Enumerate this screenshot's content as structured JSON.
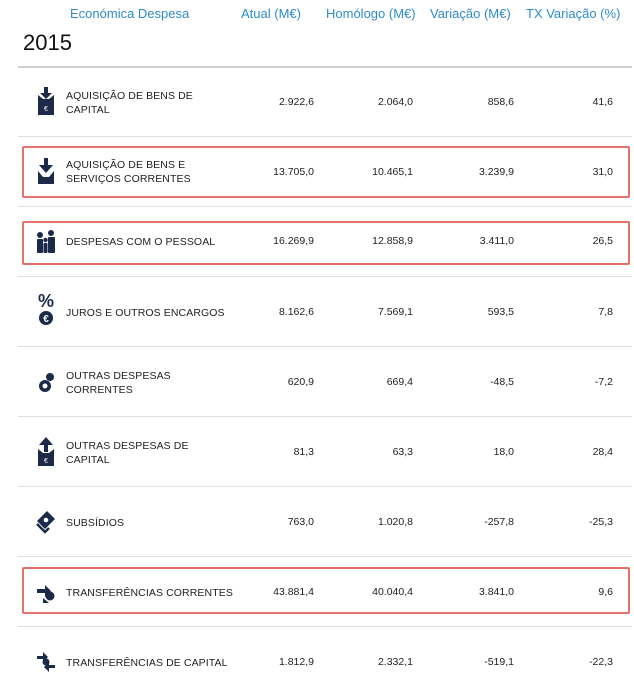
{
  "header": {
    "category": "Económica Despesa",
    "current": "Atual (M€)",
    "previous": "Homólogo (M€)",
    "variation": "Variação (M€)",
    "variation_rate": "TX Variação (%)"
  },
  "year": "2015",
  "rows": [
    {
      "label_l1": "AQUISIÇÃO DE BENS DE",
      "label_l2": "CAPITAL",
      "icon": "capital-goods-icon",
      "current": "2.922,6",
      "previous": "2.064,0",
      "variation": "858,6",
      "rate": "41,6",
      "highlighted": false
    },
    {
      "label_l1": "AQUISIÇÃO DE BENS E",
      "label_l2": "SERVIÇOS CORRENTES",
      "icon": "goods-services-icon",
      "current": "13.705,0",
      "previous": "10.465,1",
      "variation": "3.239,9",
      "rate": "31,0",
      "highlighted": true
    },
    {
      "label_l1": "DESPESAS COM O PESSOAL",
      "label_l2": "",
      "icon": "people-icon",
      "current": "16.269,9",
      "previous": "12.858,9",
      "variation": "3.411,0",
      "rate": "26,5",
      "highlighted": true
    },
    {
      "label_l1": "JUROS E OUTROS ENCARGOS",
      "label_l2": "",
      "icon": "percent-euro-icon",
      "current": "8.162,6",
      "previous": "7.569,1",
      "variation": "593,5",
      "rate": "7,8",
      "highlighted": false
    },
    {
      "label_l1": "OUTRAS DESPESAS",
      "label_l2": "CORRENTES",
      "icon": "coins-icon",
      "current": "620,9",
      "previous": "669,4",
      "variation": "-48,5",
      "rate": "-7,2",
      "highlighted": false
    },
    {
      "label_l1": "OUTRAS DESPESAS DE",
      "label_l2": "CAPITAL",
      "icon": "capital-out-icon",
      "current": "81,3",
      "previous": "63,3",
      "variation": "18,0",
      "rate": "28,4",
      "highlighted": false
    },
    {
      "label_l1": "SUBSÍDIOS",
      "label_l2": "",
      "icon": "subsidy-icon",
      "current": "763,0",
      "previous": "1.020,8",
      "variation": "-257,8",
      "rate": "-25,3",
      "highlighted": false
    },
    {
      "label_l1": "TRANSFERÊNCIAS CORRENTES",
      "label_l2": "",
      "icon": "transfer-current-icon",
      "current": "43.881,4",
      "previous": "40.040,4",
      "variation": "3.841,0",
      "rate": "9,6",
      "highlighted": true
    },
    {
      "label_l1": "TRANSFERÊNCIAS DE CAPITAL",
      "label_l2": "",
      "icon": "transfer-capital-icon",
      "current": "1.812,9",
      "previous": "2.332,1",
      "variation": "-519,1",
      "rate": "-22,3",
      "highlighted": false
    }
  ],
  "colors": {
    "header_text": "#2e8bc9",
    "icon_navy": "#1c2a4a",
    "highlight_border": "#e57268"
  }
}
